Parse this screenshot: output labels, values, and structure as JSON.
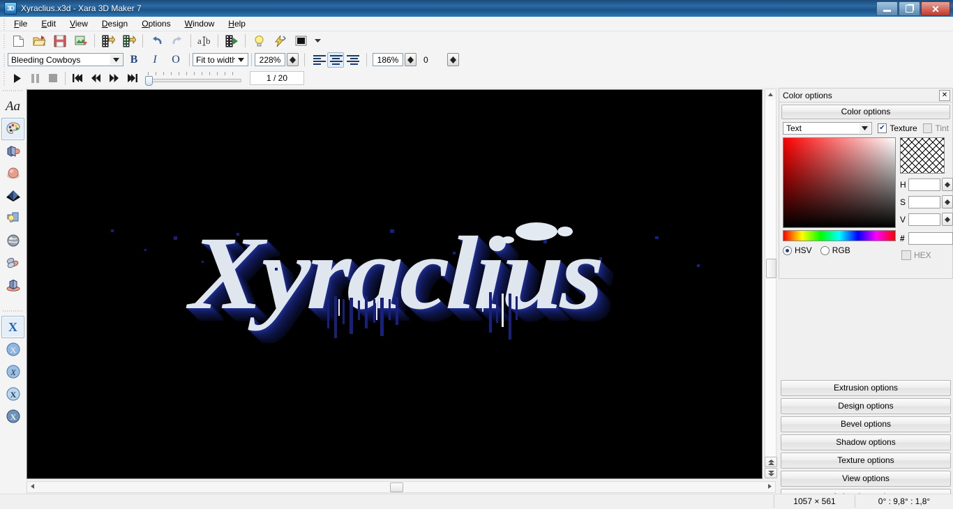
{
  "window": {
    "title": "Xyraclius.x3d - Xara 3D Maker 7",
    "app_icon": "3d-cube-icon",
    "buttons": {
      "minimize": "minimize-icon",
      "restore": "restore-icon",
      "close": "close-icon"
    }
  },
  "menubar": {
    "items": [
      {
        "label": "File",
        "mnemonic": "F"
      },
      {
        "label": "Edit",
        "mnemonic": "E"
      },
      {
        "label": "View",
        "mnemonic": "V"
      },
      {
        "label": "Design",
        "mnemonic": "D"
      },
      {
        "label": "Options",
        "mnemonic": "O"
      },
      {
        "label": "Window",
        "mnemonic": "W"
      },
      {
        "label": "Help",
        "mnemonic": "H"
      }
    ]
  },
  "toolbar_main": {
    "buttons": [
      {
        "name": "new-document-button",
        "icon": "new-page-icon",
        "tooltip": "New"
      },
      {
        "name": "open-button",
        "icon": "open-folder-icon",
        "tooltip": "Open"
      },
      {
        "name": "save-button",
        "icon": "floppy-disk-icon",
        "tooltip": "Save"
      },
      {
        "name": "export-button",
        "icon": "export-image-icon",
        "tooltip": "Export"
      },
      {
        "name": "import-animation-button",
        "icon": "film-import-icon",
        "tooltip": "Import animation"
      },
      {
        "name": "export-animation-button",
        "icon": "film-export-icon",
        "tooltip": "Export animation"
      },
      {
        "name": "undo-button",
        "icon": "undo-arrow-icon",
        "tooltip": "Undo"
      },
      {
        "name": "redo-button",
        "icon": "redo-arrow-icon",
        "tooltip": "Redo"
      },
      {
        "name": "text-options-button",
        "icon": "a-b-text-icon",
        "tooltip": "Text options"
      },
      {
        "name": "play-animation-button",
        "icon": "film-play-icon",
        "tooltip": "Preview animation"
      },
      {
        "name": "lighting-button",
        "icon": "light-bulb-icon",
        "tooltip": "Lighting"
      },
      {
        "name": "quick-shading-button",
        "icon": "lightning-bolt-icon",
        "tooltip": "Quick render"
      },
      {
        "name": "background-color-button",
        "icon": "color-swatch-icon",
        "tooltip": "Background color"
      },
      {
        "name": "background-dropdown-button",
        "icon": "chevron-down-icon",
        "tooltip": "More"
      }
    ]
  },
  "toolbar_text": {
    "font": {
      "value": "Bleeding Cowboys",
      "placeholder": "Font"
    },
    "bold_label": "B",
    "italic_label": "I",
    "outline_label": "O",
    "fit_mode": {
      "value": "Fit to width"
    },
    "zoom": {
      "value": "228%"
    },
    "size": {
      "value": "186%"
    },
    "rotation": {
      "value": "0"
    },
    "align": [
      {
        "name": "align-left-button",
        "state": "off"
      },
      {
        "name": "align-center-button",
        "state": "on"
      },
      {
        "name": "align-right-button",
        "state": "off"
      }
    ]
  },
  "transport": {
    "play": "play-icon",
    "pause": "pause-icon",
    "stop": "stop-icon",
    "first": "skip-first-icon",
    "rewind": "rewind-icon",
    "forward": "fast-forward-icon",
    "last": "skip-last-icon",
    "frame_counter": "1 / 20"
  },
  "left_rail": {
    "top_tools": [
      {
        "name": "text-tool-button",
        "icon": "Aa",
        "label": "Text options",
        "selected": false
      },
      {
        "name": "color-tool-button",
        "icon": "palette-icon",
        "label": "Color options",
        "selected": true
      },
      {
        "name": "extrusion-tool-button",
        "icon": "extrude-cube-icon",
        "label": "Extrusion options",
        "selected": false
      },
      {
        "name": "bevel-tool-button",
        "icon": "bevel-sphere-icon",
        "label": "Bevel options",
        "selected": false
      },
      {
        "name": "shadow-tool-button",
        "icon": "shadow-diamond-icon",
        "label": "Shadow options",
        "selected": false
      },
      {
        "name": "lighting-tool-button",
        "icon": "light-bulb-icon",
        "label": "Lighting options",
        "selected": false
      },
      {
        "name": "texture-tool-button",
        "icon": "marble-ball-icon",
        "label": "Texture options",
        "selected": false
      },
      {
        "name": "animation-tool-button",
        "icon": "animation-rolls-icon",
        "label": "Animation options",
        "selected": false
      },
      {
        "name": "view-tool-button",
        "icon": "cube-on-plate-icon",
        "label": "View options",
        "selected": false
      }
    ],
    "preset_tools": [
      {
        "name": "style-preset-1-button",
        "icon": "x-flat-icon",
        "selected": true
      },
      {
        "name": "style-preset-2-button",
        "icon": "x-round-icon",
        "selected": false
      },
      {
        "name": "style-preset-3-button",
        "icon": "x-italic-icon",
        "selected": false
      },
      {
        "name": "style-preset-4-button",
        "icon": "x-bevel-icon",
        "selected": false
      },
      {
        "name": "style-preset-5-button",
        "icon": "x-shadow-icon",
        "selected": false
      }
    ]
  },
  "canvas": {
    "artwork_text": "Xyraclius",
    "background_color": "#000000",
    "face_color": "#dfe6ee",
    "extrusion_color": "#17207d"
  },
  "panel": {
    "title": "Color options",
    "close_icon": "close-icon",
    "header_button": "Color options",
    "target_select": {
      "value": "Text"
    },
    "texture_checkbox": {
      "label": "Texture",
      "checked": true
    },
    "tint_checkbox": {
      "label": "Tint",
      "checked": false
    },
    "fields": [
      {
        "label": "H",
        "value": ""
      },
      {
        "label": "S",
        "value": ""
      },
      {
        "label": "V",
        "value": ""
      }
    ],
    "hash_label": "#",
    "hex_value": "",
    "color_model": [
      {
        "label": "HSV",
        "selected": true,
        "disabled": false
      },
      {
        "label": "RGB",
        "selected": false,
        "disabled": false
      }
    ],
    "hex_checkbox": {
      "label": "HEX",
      "checked": false,
      "disabled": true
    },
    "section_buttons": [
      {
        "name": "extrusion-options-button",
        "label": "Extrusion options"
      },
      {
        "name": "design-options-button",
        "label": "Design options"
      },
      {
        "name": "bevel-options-button",
        "label": "Bevel options"
      },
      {
        "name": "shadow-options-button",
        "label": "Shadow options"
      },
      {
        "name": "texture-options-button",
        "label": "Texture options"
      },
      {
        "name": "view-options-button",
        "label": "View options"
      },
      {
        "name": "animation-options-button",
        "label": "Animation options"
      }
    ]
  },
  "statusbar": {
    "dimensions": "1057 × 561",
    "angles": "0° : 9,8° : 1,8°"
  }
}
